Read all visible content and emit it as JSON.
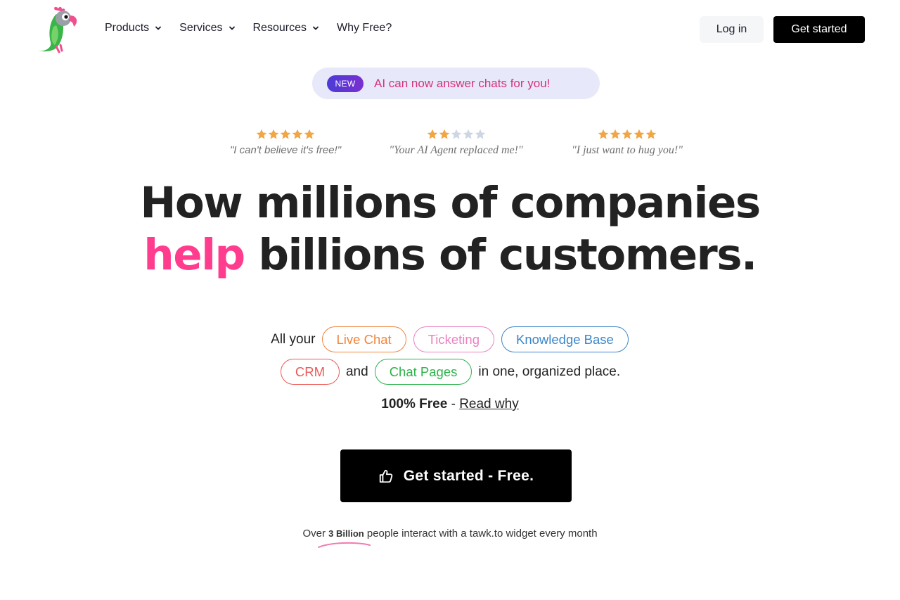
{
  "nav": {
    "logo_name": "parrot-logo",
    "items": [
      {
        "label": "Products",
        "has_dropdown": true
      },
      {
        "label": "Services",
        "has_dropdown": true
      },
      {
        "label": "Resources",
        "has_dropdown": true
      },
      {
        "label": "Why Free?",
        "has_dropdown": false
      }
    ],
    "login_label": "Log in",
    "get_started_label": "Get started"
  },
  "announcement": {
    "badge": "NEW",
    "text": "AI can now answer chats for you!"
  },
  "reviews": [
    {
      "rating": 5,
      "max": 5,
      "quote": "\"I can't believe it's free!\""
    },
    {
      "rating": 2,
      "max": 5,
      "quote": "\"Your AI Agent replaced me!\""
    },
    {
      "rating": 5,
      "max": 5,
      "quote": "\"I just want to hug you!\""
    }
  ],
  "headline": {
    "line1": "How millions of companies",
    "accent": "help",
    "line2_rest": " billions of customers."
  },
  "features": {
    "prefix": "All your",
    "chips": {
      "live_chat": "Live Chat",
      "ticketing": "Ticketing",
      "knowledge_base": "Knowledge Base",
      "crm": "CRM",
      "chat_pages": "Chat Pages"
    },
    "and": "and",
    "suffix": "in one, organized place."
  },
  "pricing": {
    "free_text": "100% Free",
    "separator": " - ",
    "read_why": "Read why"
  },
  "cta": {
    "label": "Get started - Free.",
    "icon": "thumbs-up-icon"
  },
  "stat": {
    "pre": "Over ",
    "highlight": "3 Billion",
    "post": " people interact with a tawk.to widget every month"
  },
  "colors": {
    "accent_pink": "#ff3c8e",
    "star_gold": "#f0a644",
    "star_empty": "#cfd6e3",
    "announce_bg": "#e8e8fb",
    "announce_text": "#d6327a",
    "chip_live_chat": "#f0853b",
    "chip_ticketing": "#e982c0",
    "chip_kb": "#3b86c9",
    "chip_crm": "#ea5a57",
    "chip_chat_pages": "#2cb34a"
  }
}
